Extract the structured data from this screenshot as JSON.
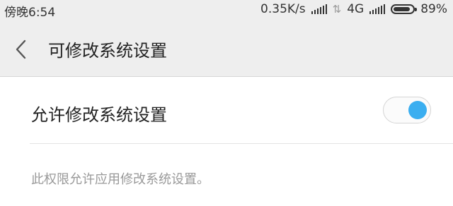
{
  "status_bar": {
    "time": "傍晚6:54",
    "network_speed": "0.35K/s",
    "network_type": "4G",
    "battery_percent": "89%",
    "battery_level": 0.89
  },
  "header": {
    "back_icon": "chevron-left-icon",
    "title": "可修改系统设置"
  },
  "setting": {
    "label": "允许修改系统设置",
    "enabled": true
  },
  "description": "此权限允许应用修改系统设置。",
  "colors": {
    "accent": "#3aaef0",
    "header_background": "#eeeeee",
    "secondary_text": "#999999"
  }
}
